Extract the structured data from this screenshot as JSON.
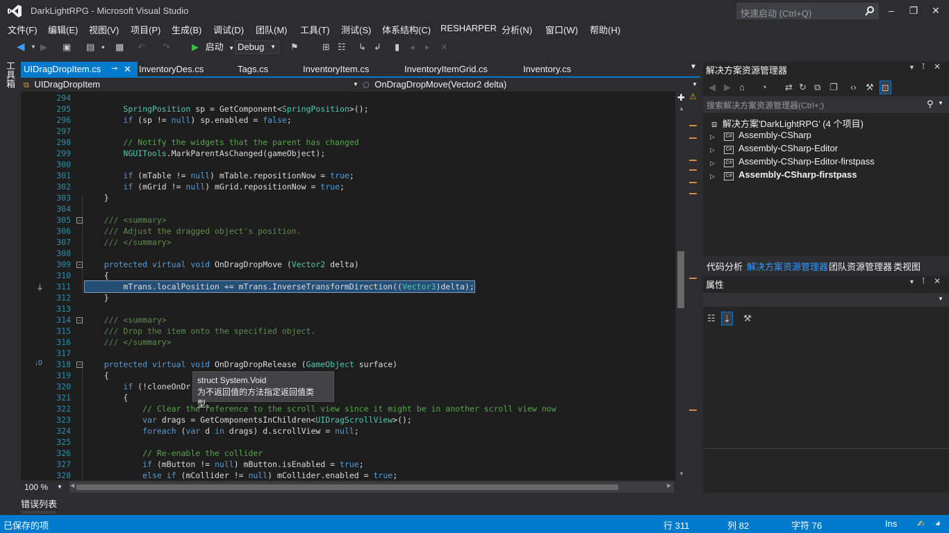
{
  "window": {
    "title": "DarkLightRPG - Microsoft Visual Studio",
    "quick_launch_placeholder": "快速启动 (Ctrl+Q)"
  },
  "menu": [
    "文件(F)",
    "编辑(E)",
    "视图(V)",
    "项目(P)",
    "生成(B)",
    "调试(D)",
    "团队(M)",
    "工具(T)",
    "测试(S)",
    "体系结构(C)",
    "RESHARPER",
    "分析(N)",
    "窗口(W)",
    "帮助(H)"
  ],
  "toolbar": {
    "start_label": "启动",
    "config_value": "Debug"
  },
  "toolbox_label": "工具箱",
  "editor_tabs": [
    "UIDragDropItem.cs",
    "InventoryDes.cs",
    "Tags.cs",
    "InventoryItem.cs",
    "InventoryItemGrid.cs",
    "Inventory.cs"
  ],
  "navbar": {
    "type_selector": "UIDragDropItem",
    "member_selector": "OnDragDropMove(Vector2 delta)"
  },
  "code_lines": [
    {
      "n": "294",
      "text": ""
    },
    {
      "n": "295",
      "text": "        SpringPosition sp = GetComponent<SpringPosition>();"
    },
    {
      "n": "296",
      "text": "        if (sp != null) sp.enabled = false;"
    },
    {
      "n": "297",
      "text": ""
    },
    {
      "n": "298",
      "text": "        // Notify the widgets that the parent has changed"
    },
    {
      "n": "299",
      "text": "        NGUITools.MarkParentAsChanged(gameObject);"
    },
    {
      "n": "300",
      "text": ""
    },
    {
      "n": "301",
      "text": "        if (mTable != null) mTable.repositionNow = true;"
    },
    {
      "n": "302",
      "text": "        if (mGrid != null) mGrid.repositionNow = true;"
    },
    {
      "n": "303",
      "text": "    }"
    },
    {
      "n": "304",
      "text": ""
    },
    {
      "n": "305",
      "text": "    /// <summary>"
    },
    {
      "n": "306",
      "text": "    /// Adjust the dragged object's position."
    },
    {
      "n": "307",
      "text": "    /// </summary>"
    },
    {
      "n": "308",
      "text": ""
    },
    {
      "n": "309",
      "text": "    protected virtual void OnDragDropMove (Vector2 delta)"
    },
    {
      "n": "310",
      "text": "    {"
    },
    {
      "n": "311",
      "text": "        mTrans.localPosition += mTrans.InverseTransformDirection((Vector3)delta);"
    },
    {
      "n": "312",
      "text": "    }"
    },
    {
      "n": "313",
      "text": ""
    },
    {
      "n": "314",
      "text": "    /// <summary>"
    },
    {
      "n": "315",
      "text": "    /// Drop the item onto the specified object."
    },
    {
      "n": "316",
      "text": "    /// </summary>"
    },
    {
      "n": "317",
      "text": ""
    },
    {
      "n": "318",
      "text": "    protected virtual void OnDragDropRelease (GameObject surface)"
    },
    {
      "n": "319",
      "text": "    {"
    },
    {
      "n": "320",
      "text": "        if (!cloneOnDr"
    },
    {
      "n": "321",
      "text": "        {"
    },
    {
      "n": "322",
      "text": "            // Clear the reference to the scroll view since it might be in another scroll view now"
    },
    {
      "n": "323",
      "text": "            var drags = GetComponentsInChildren<UIDragScrollView>();"
    },
    {
      "n": "324",
      "text": "            foreach (var d in drags) d.scrollView = null;"
    },
    {
      "n": "325",
      "text": ""
    },
    {
      "n": "326",
      "text": "            // Re-enable the collider"
    },
    {
      "n": "327",
      "text": "            if (mButton != null) mButton.isEnabled = true;"
    },
    {
      "n": "328",
      "text": "            else if (mCollider != null) mCollider.enabled = true;"
    }
  ],
  "tooltip": {
    "line1": "struct System.Void",
    "line2": "为不返回值的方法指定返回值类型。"
  },
  "zoom": "100 %",
  "error_list_label": "错误列表",
  "status": {
    "message": "已保存的项",
    "row": "行 311",
    "col": "列 82",
    "char": "字符 76",
    "mode": "Ins"
  },
  "solution_explorer": {
    "title": "解决方案资源管理器",
    "search_placeholder": "搜索解决方案资源管理器(Ctrl+;)",
    "root": "解决方案'DarkLightRPG' (4 个项目)",
    "projects": [
      "Assembly-CSharp",
      "Assembly-CSharp-Editor",
      "Assembly-CSharp-Editor-firstpass",
      "Assembly-CSharp-firstpass"
    ]
  },
  "panel_tabs": [
    "代码分析",
    "解决方案资源管理器",
    "团队资源管理器",
    "类视图"
  ],
  "properties": {
    "title": "属性"
  },
  "colors": {
    "accent": "#007acc",
    "background": "#2d2d30",
    "editor_bg": "#1e1e1e"
  }
}
